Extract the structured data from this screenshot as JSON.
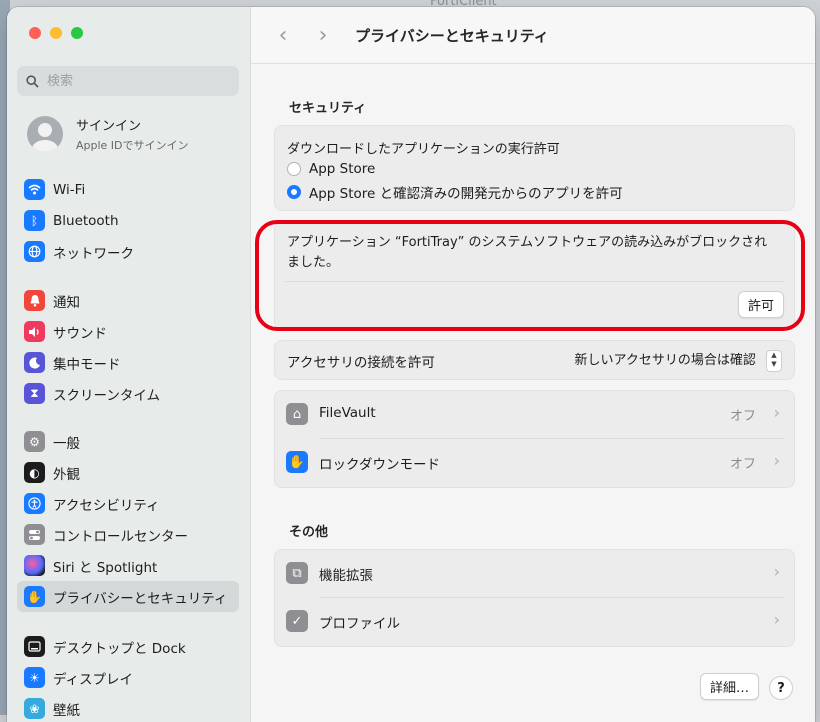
{
  "background": {
    "title": "FortiClient"
  },
  "sidebar": {
    "search_placeholder": "検索",
    "account": {
      "name": "サインイン",
      "sub": "Apple IDでサインイン"
    },
    "groups": [
      [
        {
          "label": "Wi-Fi",
          "icon": "wifi-icon",
          "color": "#1a7aff"
        },
        {
          "label": "Bluetooth",
          "icon": "bluetooth-icon",
          "color": "#1a7aff"
        },
        {
          "label": "ネットワーク",
          "icon": "globe-icon",
          "color": "#1a7aff"
        }
      ],
      [
        {
          "label": "通知",
          "icon": "bell-icon",
          "color": "#f0463c"
        },
        {
          "label": "サウンド",
          "icon": "speaker-icon",
          "color": "#ef3a5d"
        },
        {
          "label": "集中モード",
          "icon": "moon-icon",
          "color": "#5856d6"
        },
        {
          "label": "スクリーンタイム",
          "icon": "hourglass-icon",
          "color": "#5856d6"
        }
      ],
      [
        {
          "label": "一般",
          "icon": "gear-icon",
          "color": "#8e8e93"
        },
        {
          "label": "外観",
          "icon": "appearance-icon",
          "color": "#1c1c1e"
        },
        {
          "label": "アクセシビリティ",
          "icon": "accessibility-icon",
          "color": "#1a7aff"
        },
        {
          "label": "コントロールセンター",
          "icon": "toggles-icon",
          "color": "#8e8e93"
        },
        {
          "label": "Siri と Spotlight",
          "icon": "siri-icon",
          "color": "#3a3a3c"
        },
        {
          "label": "プライバシーとセキュリティ",
          "icon": "hand-icon",
          "color": "#1a7aff",
          "selected": true
        }
      ],
      [
        {
          "label": "デスクトップと Dock",
          "icon": "dock-icon",
          "color": "#1c1c1e"
        },
        {
          "label": "ディスプレイ",
          "icon": "sun-icon",
          "color": "#1a7aff"
        },
        {
          "label": "壁紙",
          "icon": "wallpaper-icon",
          "color": "#35aadc"
        }
      ]
    ]
  },
  "toolbar": {
    "back": "‹",
    "forward": "›",
    "title": "プライバシーとセキュリティ"
  },
  "security": {
    "title": "セキュリティ",
    "download_heading": "ダウンロードしたアプリケーションの実行許可",
    "options": [
      "App Store",
      "App Store と確認済みの開発元からのアプリを許可"
    ],
    "selected_option": 1,
    "blocked_message": "アプリケーション “FortiTray” のシステムソフトウェアの読み込みがブロックされました。",
    "allow_button": "許可",
    "accessory_label": "アクセサリの接続を許可",
    "accessory_value": "新しいアクセサリの場合は確認",
    "filevault": {
      "label": "FileVault",
      "value": "オフ"
    },
    "lockdown": {
      "label": "ロックダウンモード",
      "value": "オフ"
    }
  },
  "other": {
    "title": "その他",
    "extensions": {
      "label": "機能拡張"
    },
    "profiles": {
      "label": "プロファイル"
    }
  },
  "footer": {
    "details_button": "詳細…",
    "help_button": "?"
  },
  "colors": {
    "highlight": "#e80017",
    "accent": "#1a7aff"
  }
}
